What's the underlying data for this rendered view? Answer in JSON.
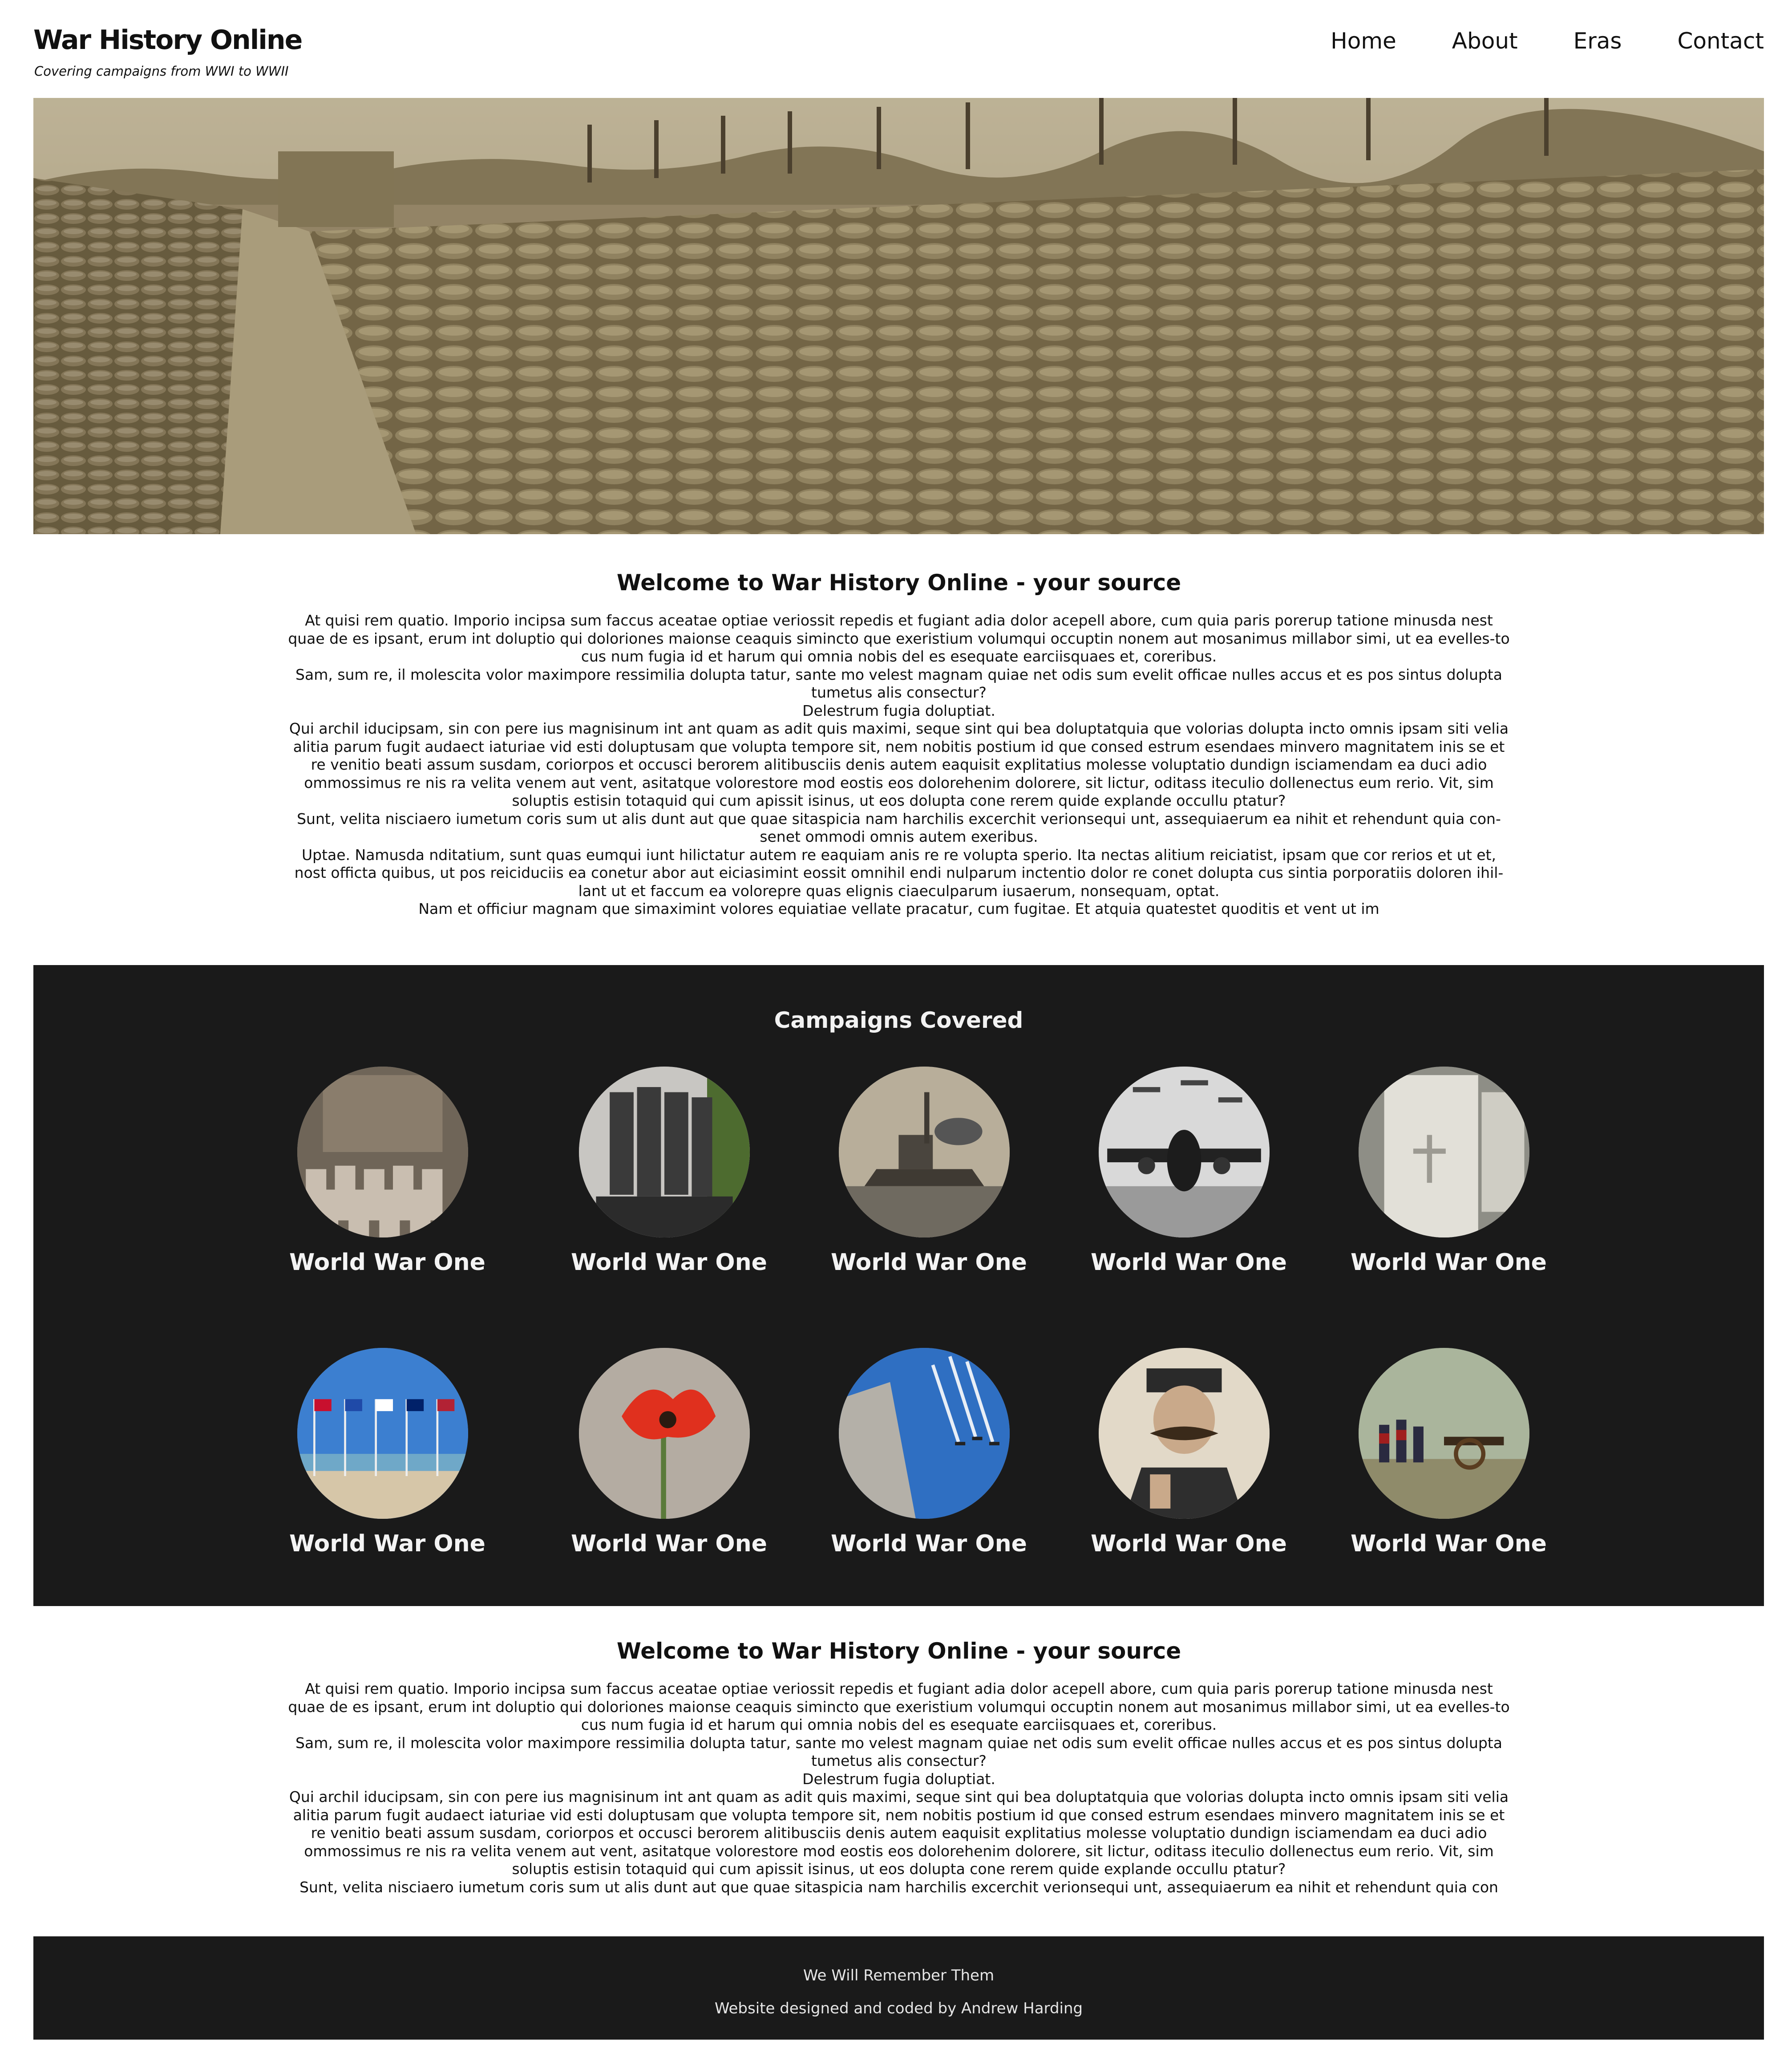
{
  "header": {
    "title": "War History Online",
    "tagline": "Covering campaigns from WWI to WWII",
    "nav": [
      "Home",
      "About",
      "Eras",
      "Contact"
    ]
  },
  "intro": {
    "heading": "Welcome to War History Online - your source",
    "paragraphs": [
      "At quisi rem quatio. Imporio incipsa sum faccus aceatae optiae veriossit repedis et fugiant adia dolor acepell abore, cum quia paris porerup tatione minusda nest quae de es ipsant, erum int doluptio qui doloriones maionse ceaquis simincto que exeristium volumqui occuptin nonem aut mosanimus millabor simi, ut ea evelles-to cus num fugia id et harum qui omnia nobis del es esequate earciisquaes et, coreribus.",
      "Sam, sum re, il molescita volor maximpore ressimilia dolupta tatur, sante mo velest magnam quiae net odis sum evelit officae nulles accus et es pos sintus dolupta tumetus alis consectur?",
      "Delestrum fugia doluptiat.",
      "Qui archil iducipsam, sin con pere ius magnisinum int ant quam as adit quis maximi, seque sint qui bea doluptatquia que volorias dolupta incto omnis ipsam siti velia alitia parum fugit audaect iaturiae vid esti doluptusam que volupta tempore sit, nem nobitis postium id que consed estrum esendaes minvero magnitatem inis se et re venitio beati assum susdam, coriorpos et occusci berorem alitibusciis denis autem eaquisit explitatius molesse voluptatio dundign isciamendam ea duci adio ommossimus re nis ra velita venem aut vent, asitatque volorestore mod eostis eos dolorehenim dolorere, sit lictur, oditass iteculio dollenectus eum rerio. Vit, sim soluptis estisin totaquid qui cum apissit isinus, ut eos dolupta cone rerem quide explande occullu ptatur?",
      "Sunt, velita nisciaero iumetum coris sum ut alis dunt aut que quae sitaspicia nam harchilis excerchit verionsequi unt, assequiaerum ea nihit et rehendunt quia con-senet ommodi omnis autem exeribus.",
      "Uptae. Namusda nditatium, sunt quas eumqui iunt hilictatur autem re eaquiam anis re re volupta sperio. Ita nectas alitium reiciatist, ipsam que cor rerios et ut et, nost officta quibus, ut pos reiciduciis ea conetur abor aut eiciasimint eossit omnihil endi nulparum inctentio dolor re conet dolupta cus sintia porporatiis doloren ihil-lant ut et faccum ea volorepre quas elignis ciaeculparum iusaerum, nonsequam, optat.",
      "Nam et officiur magnam que simaximint volores equiatiae vellate pracatur, cum fugitae. Et atquia quatestet quoditis et vent ut im"
    ]
  },
  "campaigns": {
    "heading": "Campaigns Covered",
    "items": [
      {
        "label": "World War One",
        "image": "memorial-headstones-image"
      },
      {
        "label": "World War One",
        "image": "soldier-statue-image"
      },
      {
        "label": "World War One",
        "image": "battleship-image"
      },
      {
        "label": "World War One",
        "image": "bomber-aircraft-image"
      },
      {
        "label": "World War One",
        "image": "war-grave-image"
      },
      {
        "label": "World War One",
        "image": "flags-memorial-image"
      },
      {
        "label": "World War One",
        "image": "poppy-image"
      },
      {
        "label": "World War One",
        "image": "flypast-image"
      },
      {
        "label": "World War One",
        "image": "kitchener-portrait-image"
      },
      {
        "label": "World War One",
        "image": "cannon-reenactment-image"
      }
    ]
  },
  "intro2": {
    "heading": "Welcome to War History Online - your source",
    "paragraphs": [
      "At quisi rem quatio. Imporio incipsa sum faccus aceatae optiae veriossit repedis et fugiant adia dolor acepell abore, cum quia paris porerup tatione minusda nest quae de es ipsant, erum int doluptio qui doloriones maionse ceaquis simincto que exeristium volumqui occuptin nonem aut mosanimus millabor simi, ut ea evelles-to cus num fugia id et harum qui omnia nobis del es esequate earciisquaes et, coreribus.",
      "Sam, sum re, il molescita volor maximpore ressimilia dolupta tatur, sante mo velest magnam quiae net odis sum evelit officae nulles accus et es pos sintus dolupta tumetus alis consectur?",
      "Delestrum fugia doluptiat.",
      "Qui archil iducipsam, sin con pere ius magnisinum int ant quam as adit quis maximi, seque sint qui bea doluptatquia que volorias dolupta incto omnis ipsam siti velia alitia parum fugit audaect iaturiae vid esti doluptusam que volupta tempore sit, nem nobitis postium id que consed estrum esendaes minvero magnitatem inis se et re venitio beati assum susdam, coriorpos et occusci berorem alitibusciis denis autem eaquisit explitatius molesse voluptatio dundign isciamendam ea duci adio ommossimus re nis ra velita venem aut vent, asitatque volorestore mod eostis eos dolorehenim dolorere, sit lictur, oditass iteculio dollenectus eum rerio. Vit, sim soluptis estisin totaquid qui cum apissit isinus, ut eos dolupta cone rerem quide explande occullu ptatur?",
      "Sunt, velita nisciaero iumetum coris sum ut alis dunt aut que quae sitaspicia nam harchilis excerchit verionsequi unt, assequiaerum ea nihit et rehendunt quia con"
    ]
  },
  "footer": {
    "line1": "We Will Remember Them",
    "line2": "Website designed and coded by Andrew Harding"
  },
  "colors": {
    "dark_band": "#1a1a1a",
    "sepia": "#8a7a55"
  }
}
